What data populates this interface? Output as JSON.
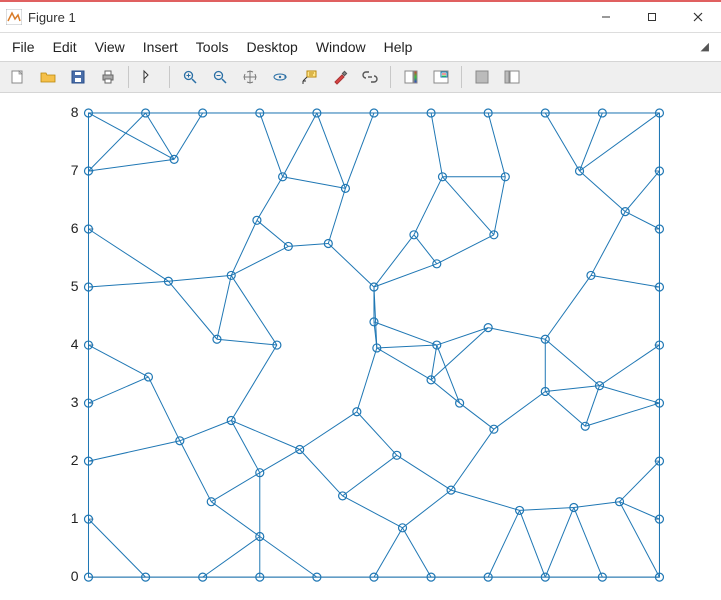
{
  "window": {
    "title": "Figure 1"
  },
  "menu": {
    "items": [
      "File",
      "Edit",
      "View",
      "Insert",
      "Tools",
      "Desktop",
      "Window",
      "Help"
    ]
  },
  "toolbar": {
    "buttons": [
      "new-figure",
      "open-file",
      "save",
      "print",
      "|",
      "edit-plot",
      "|",
      "zoom-in",
      "zoom-out",
      "pan",
      "rotate-3d",
      "data-cursor",
      "brush",
      "link",
      "|",
      "insert-colorbar",
      "insert-legend",
      "|",
      "hide-plot-tools",
      "show-plot-tools"
    ]
  },
  "chart_data": {
    "type": "scatter",
    "title": "",
    "xlabel": "",
    "ylabel": "",
    "xlim": [
      0,
      10
    ],
    "ylim": [
      0,
      8
    ],
    "yticks": [
      0,
      1,
      2,
      3,
      4,
      5,
      6,
      7,
      8
    ],
    "nodes": [
      [
        0,
        8
      ],
      [
        1,
        8
      ],
      [
        2,
        8
      ],
      [
        3,
        8
      ],
      [
        4,
        8
      ],
      [
        5,
        8
      ],
      [
        6,
        8
      ],
      [
        7,
        8
      ],
      [
        8,
        8
      ],
      [
        9,
        8
      ],
      [
        10,
        8
      ],
      [
        0,
        7
      ],
      [
        1.5,
        7.2
      ],
      [
        10,
        7
      ],
      [
        3.4,
        6.9
      ],
      [
        4.5,
        6.7
      ],
      [
        6.2,
        6.9
      ],
      [
        7.3,
        6.9
      ],
      [
        8.6,
        7.0
      ],
      [
        0,
        6
      ],
      [
        2.95,
        6.15
      ],
      [
        4.2,
        5.75
      ],
      [
        5.7,
        5.9
      ],
      [
        7.1,
        5.9
      ],
      [
        9.4,
        6.3
      ],
      [
        10,
        6
      ],
      [
        0,
        5
      ],
      [
        1.4,
        5.1
      ],
      [
        2.5,
        5.2
      ],
      [
        3.5,
        5.7
      ],
      [
        5.0,
        5.0
      ],
      [
        6.1,
        5.4
      ],
      [
        8.8,
        5.2
      ],
      [
        10,
        5
      ],
      [
        2.25,
        4.1
      ],
      [
        5.0,
        4.4
      ],
      [
        6.1,
        4.0
      ],
      [
        7.0,
        4.3
      ],
      [
        8.0,
        4.1
      ],
      [
        0,
        4
      ],
      [
        10,
        4
      ],
      [
        1.05,
        3.45
      ],
      [
        3.3,
        4.0
      ],
      [
        5.05,
        3.95
      ],
      [
        6.0,
        3.4
      ],
      [
        8.0,
        3.2
      ],
      [
        8.95,
        3.3
      ],
      [
        0,
        3
      ],
      [
        10,
        3
      ],
      [
        2.5,
        2.7
      ],
      [
        4.7,
        2.85
      ],
      [
        6.5,
        3.0
      ],
      [
        7.1,
        2.55
      ],
      [
        8.7,
        2.6
      ],
      [
        0,
        2
      ],
      [
        1.6,
        2.35
      ],
      [
        3.0,
        1.8
      ],
      [
        3.7,
        2.2
      ],
      [
        5.4,
        2.1
      ],
      [
        10,
        2
      ],
      [
        2.15,
        1.3
      ],
      [
        4.45,
        1.4
      ],
      [
        6.35,
        1.5
      ],
      [
        7.55,
        1.15
      ],
      [
        8.5,
        1.2
      ],
      [
        9.3,
        1.3
      ],
      [
        0,
        1
      ],
      [
        3.0,
        0.7
      ],
      [
        5.5,
        0.85
      ],
      [
        10,
        1
      ],
      [
        0,
        0
      ],
      [
        1,
        0
      ],
      [
        2,
        0
      ],
      [
        3,
        0
      ],
      [
        4,
        0
      ],
      [
        5,
        0
      ],
      [
        6,
        0
      ],
      [
        7,
        0
      ],
      [
        8,
        0
      ],
      [
        9,
        0
      ],
      [
        10,
        0
      ]
    ],
    "axis_box": true,
    "marker": "circle-open",
    "color": "#1f77b4"
  }
}
